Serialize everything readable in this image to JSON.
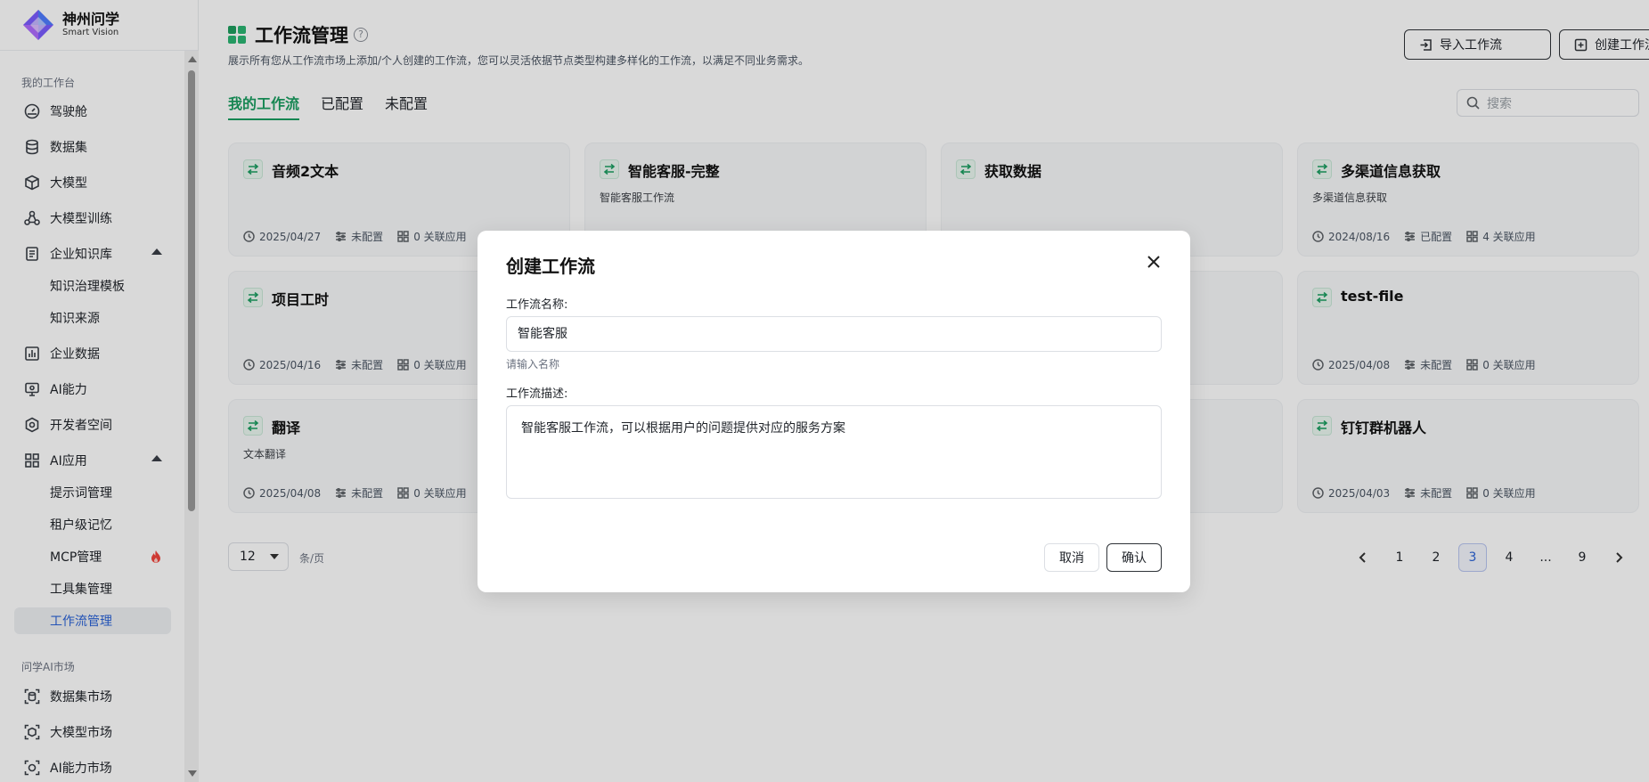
{
  "brand": {
    "name_cn": "神州问学",
    "name_en": "Smart Vision"
  },
  "sidebar": {
    "group1_title": "我的工作台",
    "items": [
      {
        "label": "驾驶舱",
        "icon": "dashboard-icon"
      },
      {
        "label": "数据集",
        "icon": "database-icon"
      },
      {
        "label": "大模型",
        "icon": "cube-icon"
      },
      {
        "label": "大模型训练",
        "icon": "training-icon"
      },
      {
        "label": "企业知识库",
        "icon": "knowledge-icon"
      },
      {
        "label": "知识治理模板"
      },
      {
        "label": "知识来源"
      },
      {
        "label": "企业数据",
        "icon": "chart-icon"
      },
      {
        "label": "AI能力",
        "icon": "monitor-icon"
      },
      {
        "label": "开发者空间",
        "icon": "dev-icon"
      },
      {
        "label": "AI应用",
        "icon": "grid-icon"
      },
      {
        "label": "提示词管理"
      },
      {
        "label": "租户级记忆"
      },
      {
        "label": "MCP管理"
      },
      {
        "label": "工具集管理"
      },
      {
        "label": "工作流管理"
      }
    ],
    "group2_title": "问学AI市场",
    "market_items": [
      {
        "label": "数据集市场"
      },
      {
        "label": "大模型市场"
      },
      {
        "label": "AI能力市场"
      }
    ]
  },
  "header": {
    "title": "工作流管理",
    "description": "展示所有您从工作流市场上添加/个人创建的工作流，您可以灵活依据节点类型构建多样化的工作流，以满足不同业务需求。",
    "import_button": "导入工作流",
    "create_button": "创建工作流"
  },
  "tabs": [
    "我的工作流",
    "已配置",
    "未配置"
  ],
  "search": {
    "placeholder": "搜索"
  },
  "cards": [
    {
      "title": "音频2文本",
      "desc": "",
      "date": "2025/04/27",
      "status": "未配置",
      "apps": "0 关联应用"
    },
    {
      "title": "智能客服-完整",
      "desc": "智能客服工作流",
      "date": "",
      "status": "",
      "apps": ""
    },
    {
      "title": "获取数据",
      "desc": "",
      "date": "",
      "status": "",
      "apps": ""
    },
    {
      "title": "多渠道信息获取",
      "desc": "多渠道信息获取",
      "date": "2024/08/16",
      "status": "已配置",
      "apps": "4 关联应用"
    },
    {
      "title": "项目工时",
      "desc": "",
      "date": "2025/04/16",
      "status": "未配置",
      "apps": "0 关联应用"
    },
    {
      "title": "test-file",
      "desc": "",
      "date": "2025/04/08",
      "status": "未配置",
      "apps": "0 关联应用"
    },
    {
      "title": "翻译",
      "desc": "文本翻译",
      "date": "2025/04/08",
      "status": "未配置",
      "apps": "0 关联应用"
    },
    {
      "title": "钉钉群机器人",
      "desc": "",
      "date": "2025/04/03",
      "status": "未配置",
      "apps": "0 关联应用"
    }
  ],
  "pagination": {
    "page_size": "12",
    "per_page_label": "条/页",
    "pages": [
      "1",
      "2",
      "3",
      "4",
      "...",
      "9"
    ],
    "current": "3"
  },
  "modal": {
    "title": "创建工作流",
    "name_label": "工作流名称:",
    "name_value": "智能客服",
    "name_hint": "请输入名称",
    "desc_label": "工作流描述:",
    "desc_value": "智能客服工作流，可以根据用户的问题提供对应的服务方案",
    "cancel": "取消",
    "confirm": "确认"
  },
  "colors": {
    "accent_green": "#1a9e61",
    "link_blue": "#2a62d6"
  }
}
